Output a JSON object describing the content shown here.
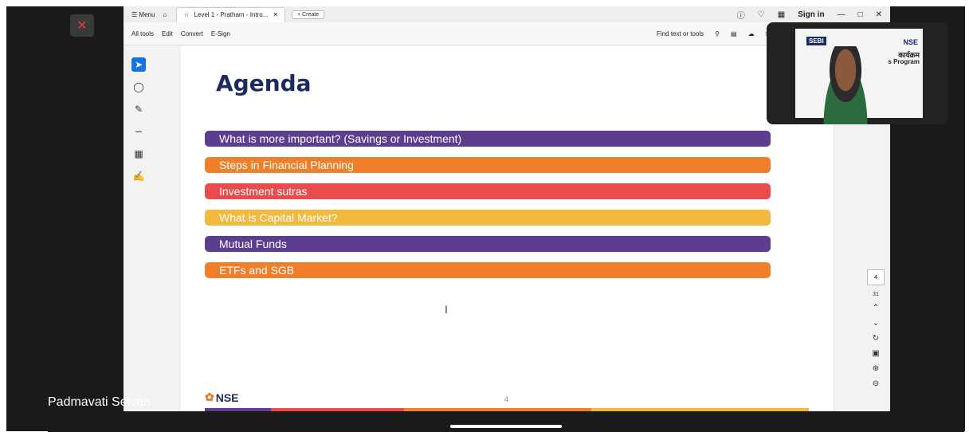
{
  "window": {
    "menu_label": "Menu",
    "tab_title": "Level 1 - Pratham - Intro...",
    "create_label": "Create",
    "signin_label": "Sign in"
  },
  "menubar": {
    "items": [
      "All tools",
      "Edit",
      "Convert",
      "E-Sign"
    ],
    "find_label": "Find text or tools"
  },
  "slide": {
    "title": "Agenda",
    "items": [
      {
        "label": "What is more important? (Savings or Investment)",
        "color": "#5b3f8e"
      },
      {
        "label": "Steps in Financial Planning",
        "color": "#ef7f2a"
      },
      {
        "label": "Investment sutras",
        "color": "#e84c4c"
      },
      {
        "label": "What is Capital Market?",
        "color": "#f1b93e"
      },
      {
        "label": "Mutual Funds",
        "color": "#5b3f8e"
      },
      {
        "label": "ETFs and SGB",
        "color": "#ef7f2a"
      }
    ],
    "footer_logo": "NSE",
    "page_number": "4"
  },
  "page_nav": {
    "current_page": "4",
    "total_pages": "31"
  },
  "webcam": {
    "sebi_label": "SEBI",
    "nse_label": "NSE",
    "line1": "कार्यक्रम",
    "line2": "s Program"
  },
  "participant": {
    "name": "Padmavati Selvan"
  }
}
